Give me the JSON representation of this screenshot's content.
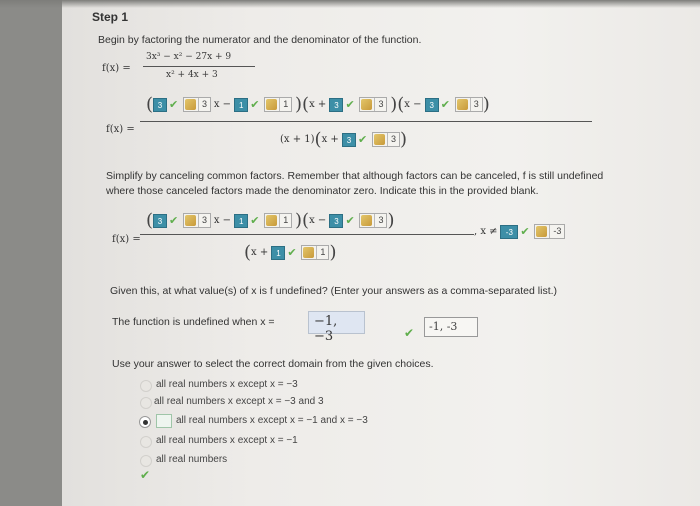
{
  "step_title": "Step 1",
  "intro": "Begin by factoring the numerator and the denominator of the function.",
  "f_label": "f(x) =",
  "numerator": "3x³ − x² − 27x + 9",
  "denominator": "x² + 4x + 3",
  "factored": {
    "b1": "3",
    "k1": "3",
    "b2": "1",
    "k2": "1",
    "b3": "3",
    "k3": "3",
    "b4": "3",
    "k4": "3",
    "den_first": "(x + 1)",
    "b5": "3",
    "k5": "3"
  },
  "simplify_line1": "Simplify by canceling common factors. Remember that although factors can be canceled, f is still undefined",
  "simplify_line2": "where those canceled factors made the denominator zero. Indicate this in the provided blank.",
  "simplified": {
    "b1": "3",
    "k1": "3",
    "b2": "1",
    "k2": "1",
    "b3": "3",
    "k3": "3",
    "b4": "1",
    "k4": "1",
    "x_neq": ", x ≠",
    "b5": "-3",
    "k5": "-3"
  },
  "question": "Given this, at what value(s) of x is f undefined? (Enter your answers as a comma-separated list.)",
  "undefined_label": "The function is undefined when x =",
  "answer_value": "−1, −3",
  "answer_shown": "-1, -3",
  "domain_prompt": "Use your answer to select the correct domain from the given choices.",
  "choices": [
    "all real numbers x except x = −3",
    "all real numbers x except x = −3 and 3",
    "all real numbers x except x = −1 and x = −3",
    "all real numbers x except x = −1",
    "all real numbers"
  ],
  "selected_choice": 2,
  "colors": {
    "blank": "#3d8fa7",
    "check": "#5fae4c",
    "answer_bg": "#dfe6f2"
  }
}
